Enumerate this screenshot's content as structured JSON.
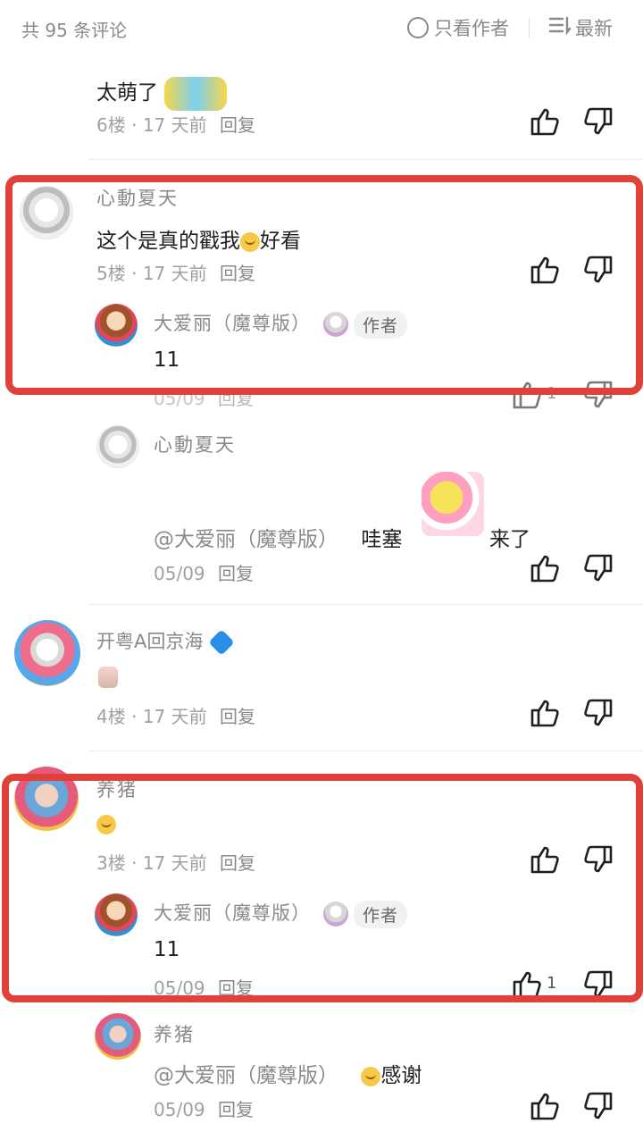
{
  "header": {
    "comment_count": "共 95 条评论",
    "only_author": "只看作者",
    "sort_label": "最新"
  },
  "comments": [
    {
      "content": "太萌了",
      "floor": "6楼",
      "time": "17 天前",
      "reply": "回复"
    },
    {
      "name": "心動夏天",
      "content": "这个是真的戳我",
      "content_suffix": "好看",
      "floor": "5楼",
      "time": "17 天前",
      "reply": "回复",
      "replies": [
        {
          "name": "大爱丽（魔尊版）",
          "tag": "作者",
          "content": "11",
          "time": "05/09",
          "reply": "回复",
          "likes": "1"
        },
        {
          "name": "心動夏天",
          "mention": "@大爱丽（魔尊版）",
          "content": "哇塞",
          "content_suffix": "来了",
          "time": "05/09",
          "reply": "回复"
        }
      ]
    },
    {
      "name": "开粤A回京海",
      "floor": "4楼",
      "time": "17 天前",
      "reply": "回复"
    },
    {
      "name": "养猪",
      "floor": "3楼",
      "time": "17 天前",
      "reply": "回复",
      "replies": [
        {
          "name": "大爱丽（魔尊版）",
          "tag": "作者",
          "content": "11",
          "time": "05/09",
          "reply": "回复",
          "likes": "1"
        },
        {
          "name": "养猪",
          "mention": "@大爱丽（魔尊版）",
          "content": "感谢",
          "time": "05/09",
          "reply": "回复"
        }
      ]
    }
  ],
  "icons": {
    "like": "thumbs-up-icon",
    "dislike": "thumbs-down-icon",
    "sort": "sort-lines-icon",
    "only_author": "circle-icon"
  },
  "colors": {
    "highlight_box": "#e0413a",
    "badge_blue": "#2a8de8"
  }
}
